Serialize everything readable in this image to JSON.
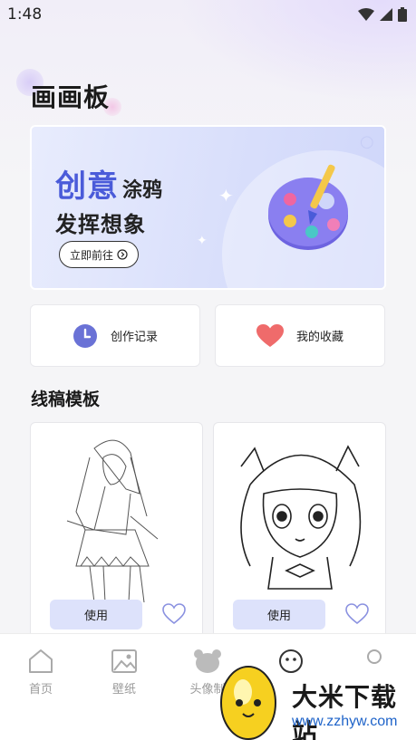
{
  "status_bar": {
    "time": "1:48"
  },
  "page": {
    "title": "画画板"
  },
  "banner": {
    "big_text": "创意",
    "small_text": "涂鸦",
    "line2": "发挥想象",
    "button_label": "立即前往"
  },
  "quick_actions": [
    {
      "label": "创作记录",
      "icon": "clock-icon",
      "color": "#6a72d6"
    },
    {
      "label": "我的收藏",
      "icon": "heart-icon",
      "color": "#ef6b6b"
    }
  ],
  "templates": {
    "title": "线稿模板",
    "items": [
      {
        "use_label": "使用"
      },
      {
        "use_label": "使用"
      }
    ]
  },
  "tabbar": {
    "tabs": [
      {
        "label": "首页",
        "icon": "home-icon"
      },
      {
        "label": "壁纸",
        "icon": "image-icon"
      },
      {
        "label": "头像制",
        "icon": "bear-icon"
      },
      {
        "label": "",
        "icon": "smile-icon"
      },
      {
        "label": "",
        "icon": "person-icon"
      }
    ]
  },
  "watermark": {
    "text": "大米下载站",
    "url": "www.zzhyw.com"
  },
  "colors": {
    "accent": "#4a5bd9",
    "button_bg": "#dde2fb"
  }
}
